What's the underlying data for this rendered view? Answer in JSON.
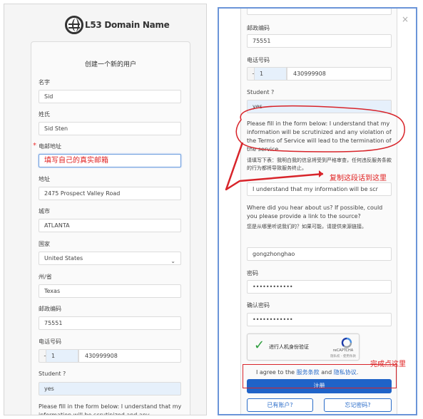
{
  "brand": {
    "logo_text": "L53 Domain Name"
  },
  "left_form": {
    "title": "创建一个新的用户",
    "name_label": "名字",
    "name_value": "Sid",
    "surname_label": "姓氏",
    "surname_value": "Sid Sten",
    "email_label": "电邮地址",
    "required_mark": "*",
    "email_note": "填写自己的真实邮箱",
    "address_label": "地址",
    "address_value": "2475  Prospect Valley Road",
    "city_label": "城市",
    "city_value": "ATLANTA",
    "country_label": "国家",
    "country_value": "United States",
    "state_label": "州/省",
    "state_value": "Texas",
    "zip_label": "邮政编码",
    "zip_value": "75551",
    "phone_label": "电话号码",
    "phone_prefix": "+",
    "phone_code": "1",
    "phone_number": "430999908",
    "student_label": "Student ?",
    "student_value": "yes",
    "notice_text": "Please fill in the form below: I understand that my information will be scrutinized and any"
  },
  "right_form": {
    "close_symbol": "×",
    "zip_label": "邮政编码",
    "zip_value": "75551",
    "phone_label": "电话号码",
    "phone_prefix": "+",
    "phone_code": "1",
    "phone_number": "430999908",
    "student_label": "Student ?",
    "student_value": "yes",
    "notice_text": "Please fill in the form below: I understand that my information will be scrutinized and any violation of the Terms of Service will lead to the termination of the service.",
    "notice_cn": "请填写下表：我明白我的信息将受到严格审查，任何违反服务条款的行为都将导致服务终止。",
    "understand_value": "I understand that my information will be scr",
    "source_question": "Where did you hear about us? If possible, could you please provide a link to the source?",
    "source_question_cn": "您是从哪里听说我们的？如果可能，请提供来源链接。",
    "source_value": "gongzhonghao",
    "password_label": "密码",
    "password_value": "••••••••••••",
    "confirm_label": "确认密码",
    "confirm_value": "••••••••••••",
    "captcha_label": "进行人机身份验证",
    "captcha_brand": "reCAPTCHA",
    "captcha_terms": "隐私权 - 使用条款",
    "agree_prefix": "I agree to the",
    "terms_link": "服务条款",
    "agree_and": "and",
    "privacy_link": "隐私协议",
    "agree_suffix": ".",
    "register_button": "注册",
    "have_account_button": "已有账户?",
    "forgot_password_button": "忘记密码?"
  },
  "annotations": {
    "copy_note": "复制这段话到这里",
    "finish_note": "完成点这里"
  },
  "colors": {
    "accent": "#1f63c8",
    "annotation_red": "#e02020",
    "panel_border": "#6b95d8"
  }
}
